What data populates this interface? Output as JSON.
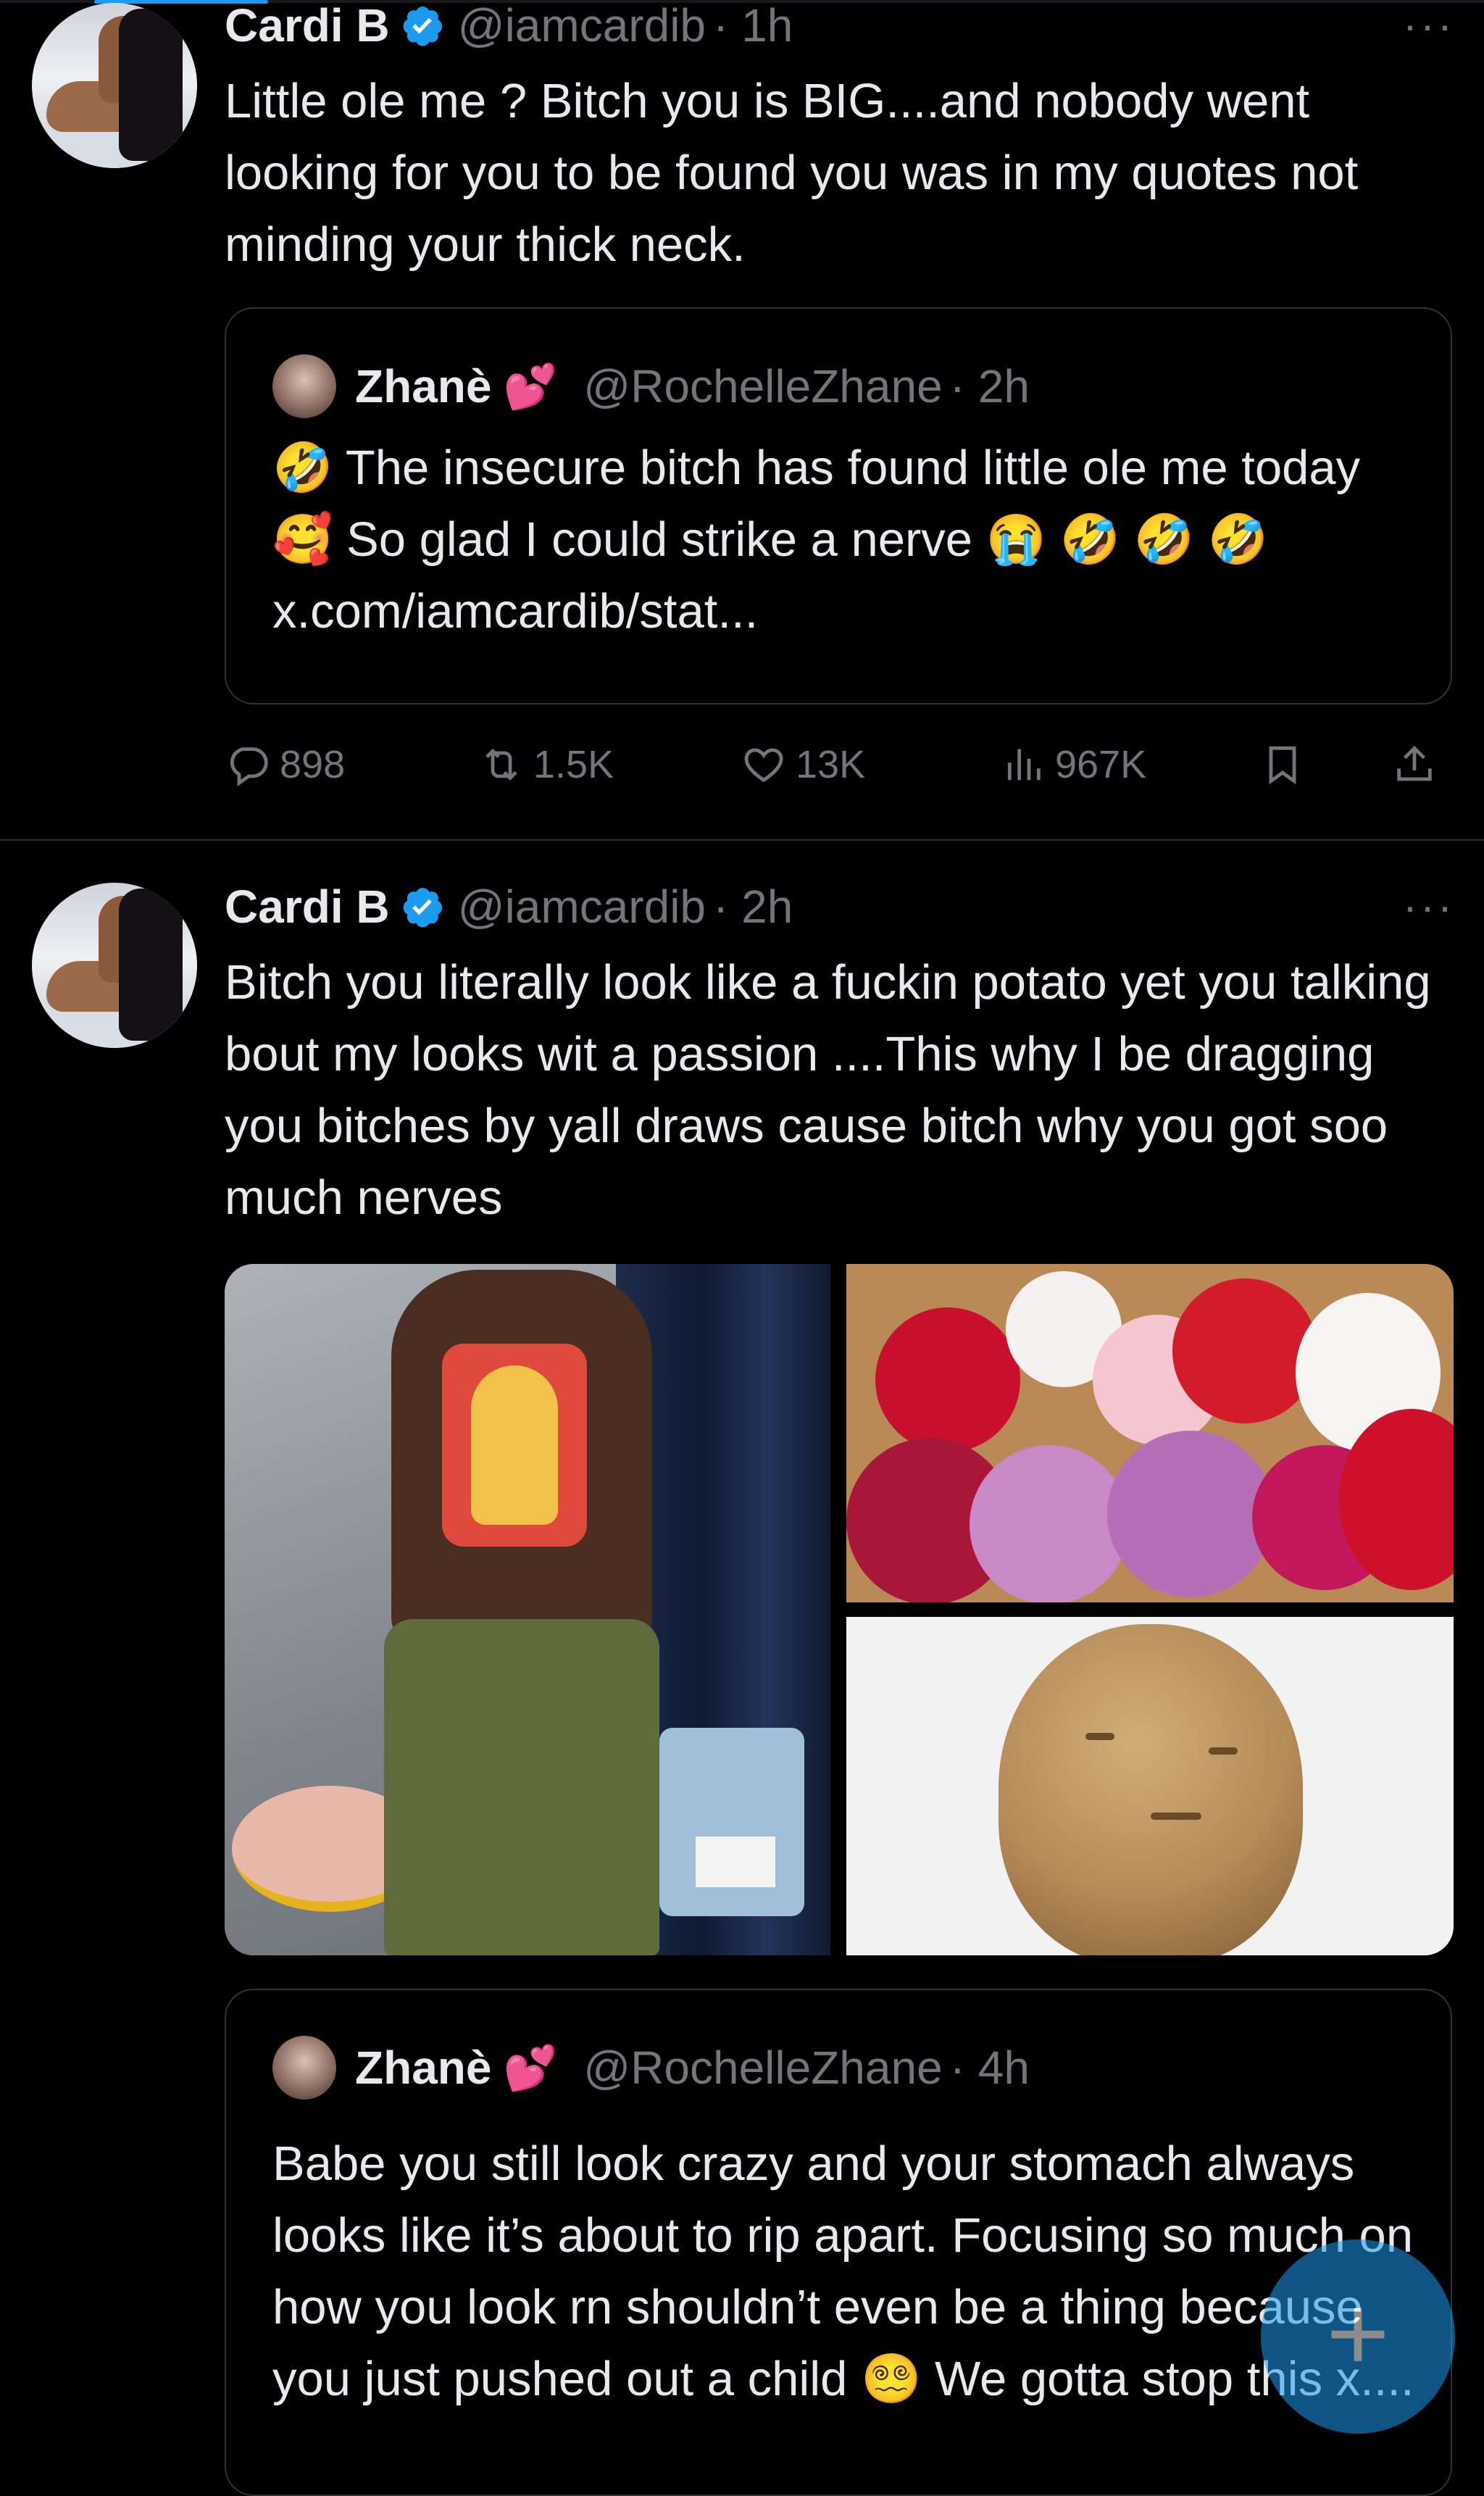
{
  "tweets": [
    {
      "name": "Cardi B",
      "handle": "@iamcardib",
      "time": "· 1h",
      "text": "Little ole me ? Bitch you is BIG....and nobody went looking for you to be found you was in my quotes not minding your thick neck.",
      "quote": {
        "name": "Zhanè",
        "heart": "💕",
        "handle": "@RochelleZhane",
        "time": "· 2h",
        "text": "🤣 The insecure bitch has found little ole me today 🥰 So glad I could strike a nerve 😭 🤣 🤣 🤣 x.com/iamcardib/stat..."
      },
      "stats": {
        "replies": "898",
        "reposts": "1.5K",
        "likes": "13K",
        "views": "967K"
      }
    },
    {
      "name": "Cardi B",
      "handle": "@iamcardib",
      "time": "· 2h",
      "text": "Bitch you literally look like a fuckin potato yet you talking bout my looks wit a passion ....This why I be dragging you bitches by yall draws cause bitch why you got soo much nerves",
      "quote": {
        "name": "Zhanè",
        "heart": "💕",
        "handle": "@RochelleZhane",
        "time": "· 4h",
        "text": "Babe you still look crazy and your stomach always looks like it’s about to rip apart. Focusing so much on how you look rn shouldn’t even be a thing because you just pushed out a child 😵‍💫 We gotta stop this x...."
      }
    }
  ],
  "more_icon": "···",
  "fab_label": "+",
  "colors": {
    "background": "#000000",
    "text": "#e7e9ea",
    "secondary": "#71767b",
    "accent": "#1d9bf0",
    "border": "#2f3336"
  },
  "icons": [
    "verified-badge-icon",
    "reply-icon",
    "repost-icon",
    "like-icon",
    "views-icon",
    "bookmark-icon",
    "share-icon",
    "more-icon",
    "compose-icon"
  ]
}
